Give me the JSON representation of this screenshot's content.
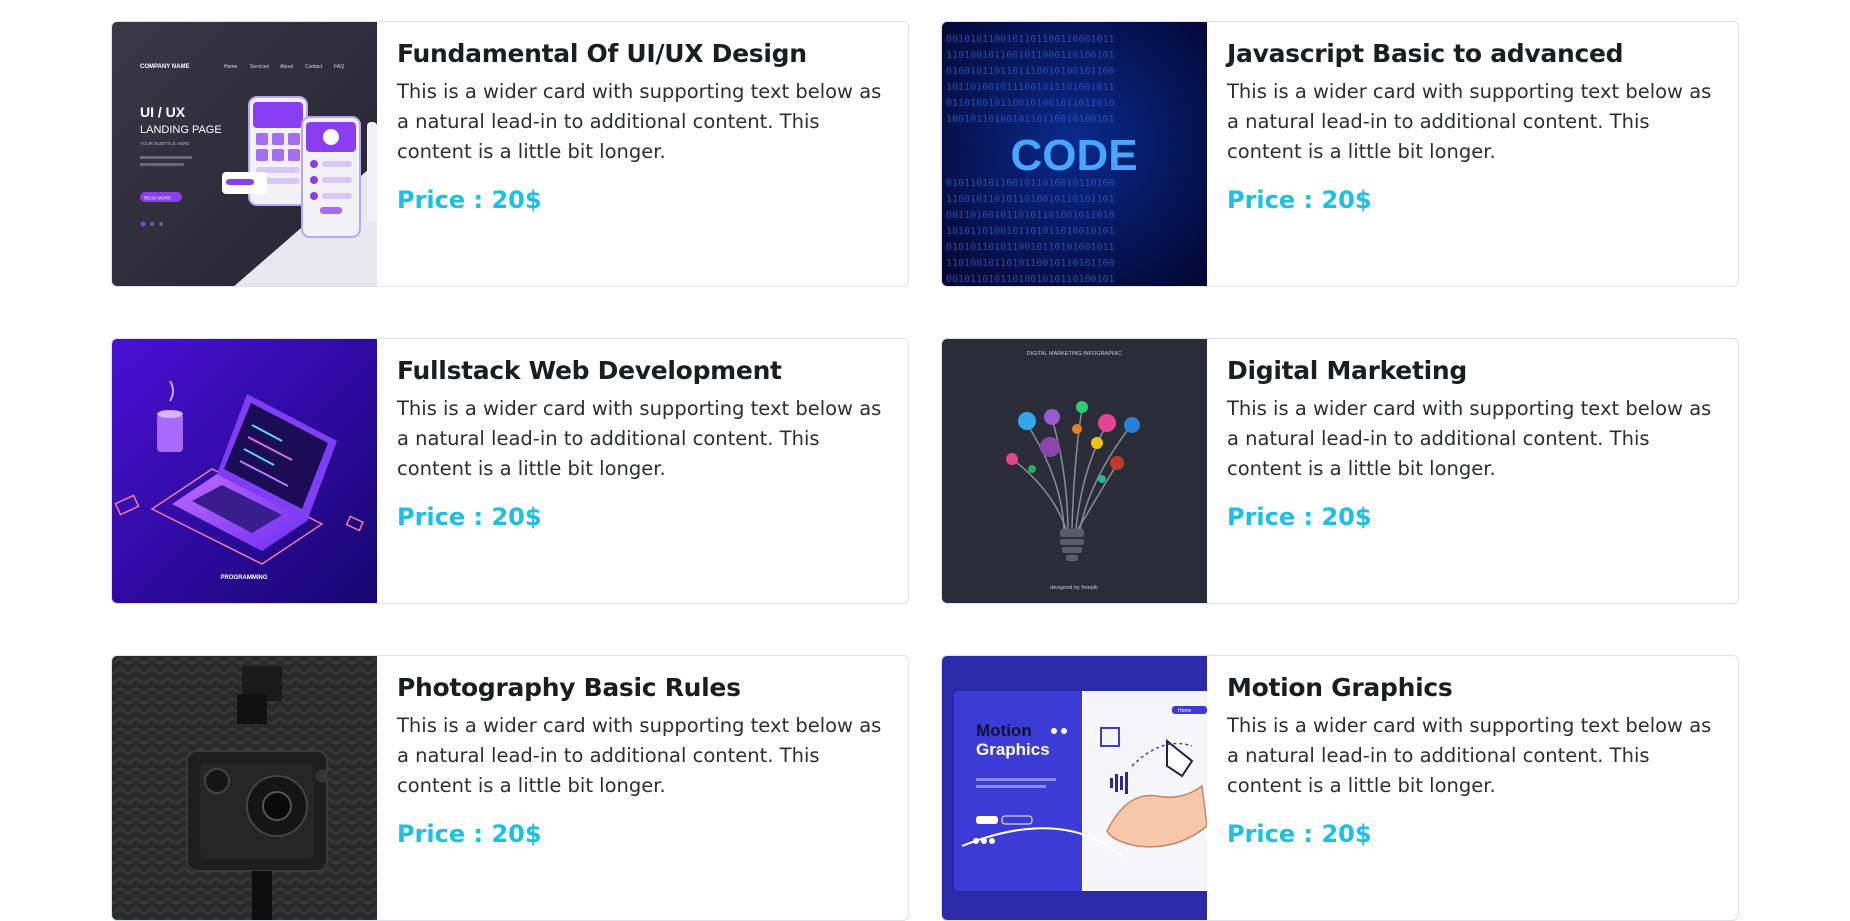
{
  "colors": {
    "price": "#1ac0e8",
    "title": "#1b1e21",
    "border": "#dfe2e6"
  },
  "courses": [
    {
      "title": "Fundamental Of UI/UX Design",
      "text": "This is a wider card with supporting text below as a natural lead-in to additional content. This content is a little bit longer.",
      "price": "Price : 20$",
      "image": "ui-ux-landing-page-illustration",
      "image_text": {
        "brand": "COMPANY NAME",
        "heading": "UI / UX",
        "sub": "LANDING PAGE",
        "tag": "YOUR SUBTITLE HERE",
        "button": "READ MORE",
        "nav": [
          "Home",
          "Services",
          "About",
          "Contact",
          "FAQ"
        ]
      }
    },
    {
      "title": "Javascript Basic to advanced",
      "text": "This is a wider card with supporting text below as a natural lead-in to additional content. This content is a little bit longer.",
      "price": "Price : 20$",
      "image": "binary-code-illustration",
      "image_text": {
        "word": "CODE"
      }
    },
    {
      "title": "Fullstack Web Development",
      "text": "This is a wider card with supporting text below as a natural lead-in to additional content. This content is a little bit longer.",
      "price": "Price : 20$",
      "image": "isometric-laptop-illustration",
      "image_text": {
        "caption": "PROGRAMMING"
      }
    },
    {
      "title": "Digital Marketing",
      "text": "This is a wider card with supporting text below as a natural lead-in to additional content. This content is a little bit longer.",
      "price": "Price : 20$",
      "image": "marketing-lightbulb-infographic",
      "image_text": {
        "heading": "DIGITAL MARKETING INFOGRAPHIC",
        "credit": "designed by freepik"
      }
    },
    {
      "title": "Photography Basic Rules",
      "text": "This is a wider card with supporting text below as a natural lead-in to additional content. This content is a little bit longer.",
      "price": "Price : 20$",
      "image": "vintage-camera-photo",
      "image_text": {}
    },
    {
      "title": "Motion Graphics",
      "text": "This is a wider card with supporting text below as a natural lead-in to additional content. This content is a little bit longer.",
      "price": "Price : 20$",
      "image": "motion-graphics-hand-pen-illustration",
      "image_text": {
        "line1": "Motion",
        "line2": "Graphics",
        "nav": "Home"
      }
    }
  ]
}
